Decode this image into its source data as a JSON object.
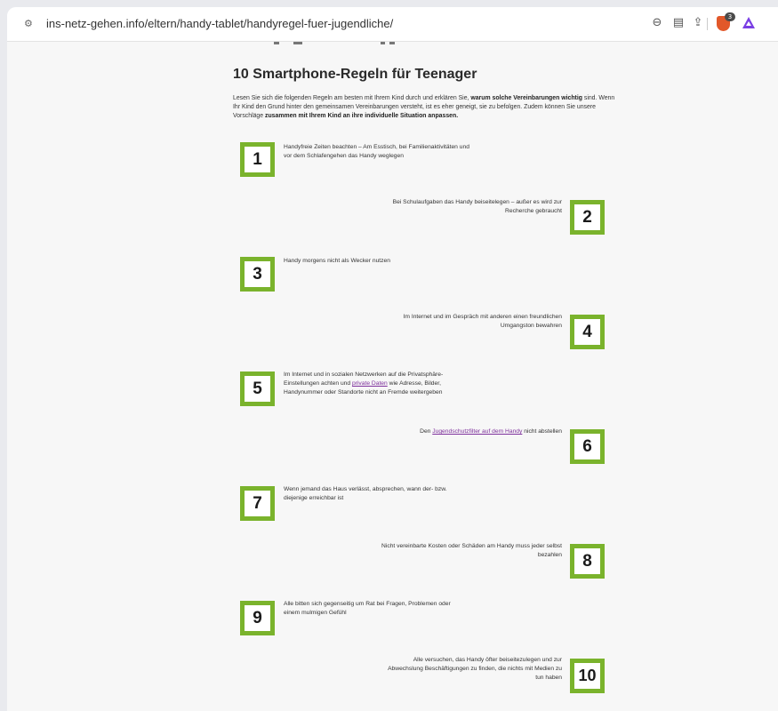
{
  "browser": {
    "url": "ins-netz-gehen.info/eltern/handy-tablet/handyregel-fuer-jugendliche/",
    "brave_badge": "3"
  },
  "article": {
    "title": "10 Smartphone-Regeln für Teenager",
    "intro_1": "Lesen Sie sich die folgenden Regeln am besten mit Ihrem Kind durch und erklären Sie, ",
    "intro_2": "warum solche Vereinbarungen wichtig",
    "intro_3": " sind. Wenn Ihr Kind den Grund hinter den gemeinsamen Vereinbarungen versteht, ist es eher geneigt, sie zu befolgen. Zudem können Sie unsere Vorschläge ",
    "intro_4": "zusammen mit Ihrem Kind an ihre individuelle Situation anpassen.",
    "rules": [
      {
        "num": "1",
        "text": "Handyfreie Zeiten beachten – Am Esstisch, bei Familienaktivitäten und vor dem Schlafengehen das Handy weglegen"
      },
      {
        "num": "2",
        "text": "Bei Schulaufgaben das Handy beiseitelegen – außer es wird zur Recherche gebraucht"
      },
      {
        "num": "3",
        "text": "Handy morgens nicht als Wecker nutzen"
      },
      {
        "num": "4",
        "text": "Im Internet und im Gespräch mit anderen einen freundlichen Umgangston bewahren"
      },
      {
        "num": "5",
        "text_a": "Im Internet und in sozialen Netzwerken auf die Privatsphäre-Einstellungen achten und ",
        "link": "private Daten",
        "text_b": " wie Adresse, Bilder, Handynummer oder Standorte nicht an Fremde weitergeben"
      },
      {
        "num": "6",
        "text_a": "Den ",
        "link": "Jugendschutzfilter auf dem Handy",
        "text_b": " nicht abstellen"
      },
      {
        "num": "7",
        "text": "Wenn jemand das Haus verlässt, absprechen, wann der- bzw. diejenige erreichbar ist"
      },
      {
        "num": "8",
        "text": "Nicht vereinbarte Kosten oder Schäden am Handy muss jeder selbst bezahlen"
      },
      {
        "num": "9",
        "text": "Alle bitten sich gegenseitig um Rat bei Fragen, Problemen oder einem mulmigen Gefühl"
      },
      {
        "num": "10",
        "text": "Alle versuchen, das Handy öfter beiseitezulegen und zur Abwechslung Beschäftigungen zu finden, die nichts mit Medien zu tun haben"
      }
    ]
  },
  "colors": {
    "accent_green": "#7ab32c",
    "link_purple": "#7d2f9b"
  }
}
